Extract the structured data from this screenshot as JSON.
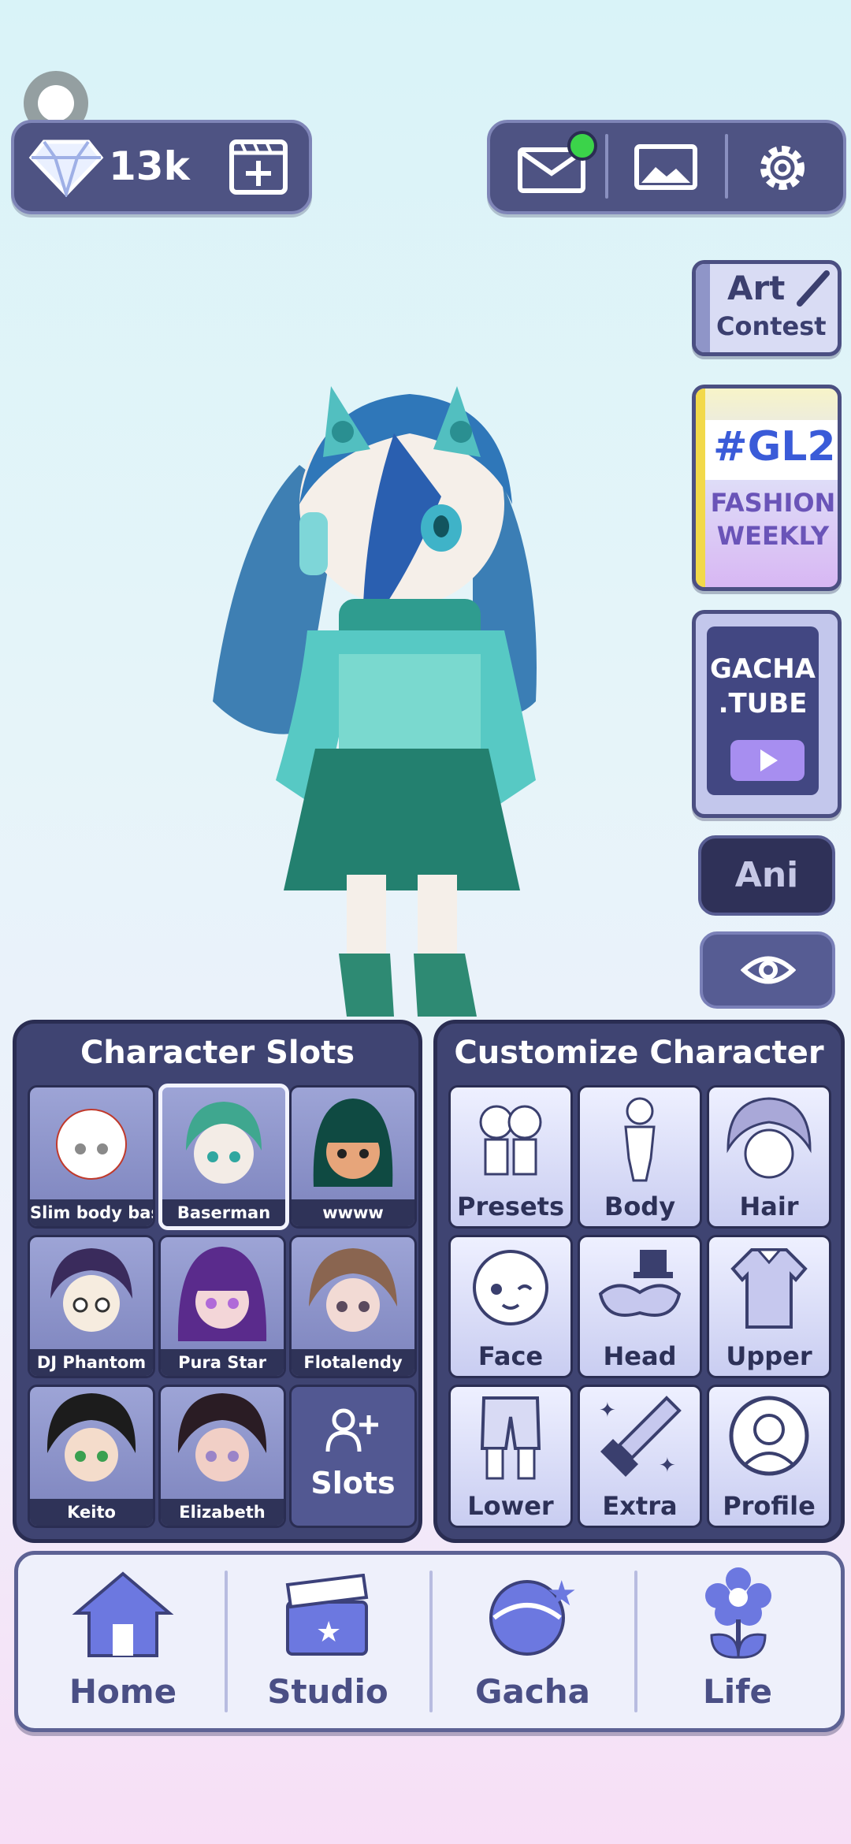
{
  "currency": {
    "gems": "13k"
  },
  "side_buttons": {
    "art_contest": {
      "line1": "Art",
      "line2": "Contest"
    },
    "gl2": {
      "tag": "#GL2",
      "line1": "FASHION",
      "line2": "WEEKLY"
    },
    "gacha_tube": {
      "line1": "GACHA",
      "line2": ".TUBE"
    },
    "ani_label": "Ani"
  },
  "character_slots": {
    "title": "Character Slots",
    "slots": [
      {
        "label": "Slim body bas"
      },
      {
        "label": "Baserman"
      },
      {
        "label": "wwww"
      },
      {
        "label": "DJ Phantom"
      },
      {
        "label": "Pura Star"
      },
      {
        "label": "Flotalendy"
      },
      {
        "label": "Keito"
      },
      {
        "label": "Elizabeth"
      }
    ],
    "add_slots_label": "Slots"
  },
  "customize": {
    "title": "Customize Character",
    "items": [
      {
        "label": "Presets"
      },
      {
        "label": "Body"
      },
      {
        "label": "Hair"
      },
      {
        "label": "Face"
      },
      {
        "label": "Head"
      },
      {
        "label": "Upper"
      },
      {
        "label": "Lower"
      },
      {
        "label": "Extra"
      },
      {
        "label": "Profile"
      }
    ]
  },
  "nav": {
    "items": [
      {
        "label": "Home"
      },
      {
        "label": "Studio"
      },
      {
        "label": "Gacha"
      },
      {
        "label": "Life"
      }
    ]
  },
  "colors": {
    "panel": "#3f4472",
    "accent_notification": "#3bd34a",
    "nav_text": "#4a4f85"
  }
}
